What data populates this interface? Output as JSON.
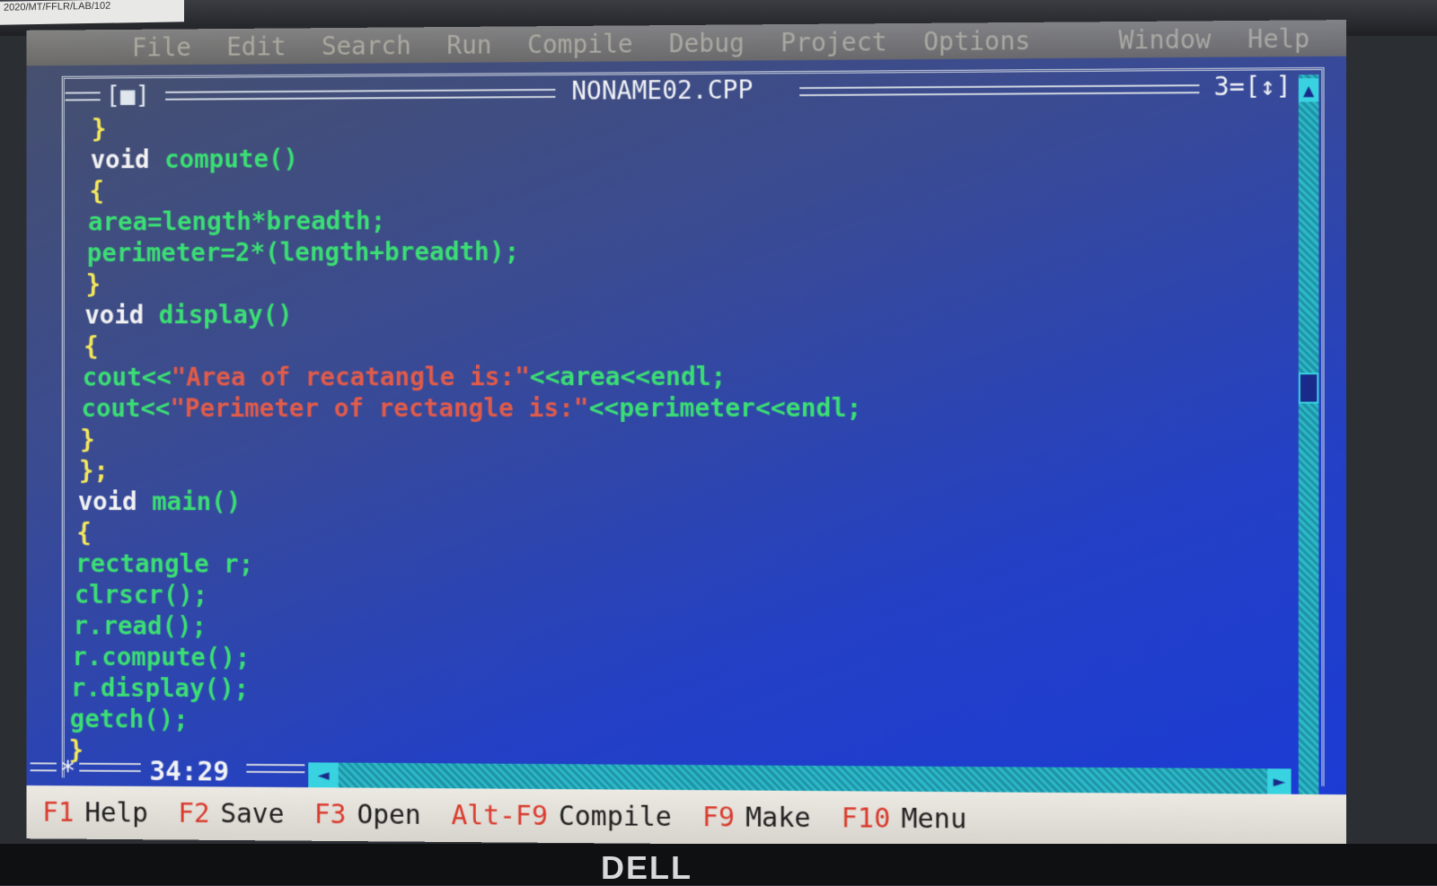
{
  "sticker": "2020/MT/FFLR/LAB/102",
  "brand": "DELL",
  "menu": [
    "File",
    "Edit",
    "Search",
    "Run",
    "Compile",
    "Debug",
    "Project",
    "Options",
    "Window",
    "Help"
  ],
  "window": {
    "close_box": "[■]",
    "filename": "NONAME02.CPP",
    "number": "3",
    "zoom_box": "[↕]"
  },
  "code_lines": [
    {
      "parts": [
        {
          "t": "}",
          "c": "br"
        }
      ]
    },
    {
      "parts": [
        {
          "t": "void ",
          "c": "kw"
        },
        {
          "t": "compute()",
          "c": "id"
        }
      ]
    },
    {
      "parts": [
        {
          "t": "{",
          "c": "br"
        }
      ]
    },
    {
      "parts": [
        {
          "t": "area=length*breadth;",
          "c": "id"
        }
      ]
    },
    {
      "parts": [
        {
          "t": "perimeter=2*(length+breadth);",
          "c": "id"
        }
      ]
    },
    {
      "parts": [
        {
          "t": "}",
          "c": "br"
        }
      ]
    },
    {
      "parts": [
        {
          "t": "void ",
          "c": "kw"
        },
        {
          "t": "display()",
          "c": "id"
        }
      ]
    },
    {
      "parts": [
        {
          "t": "{",
          "c": "br"
        }
      ]
    },
    {
      "parts": [
        {
          "t": "cout<<",
          "c": "id"
        },
        {
          "t": "\"Area of recatangle is:\"",
          "c": "str"
        },
        {
          "t": "<<area<<endl;",
          "c": "id"
        }
      ]
    },
    {
      "parts": [
        {
          "t": "cout<<",
          "c": "id"
        },
        {
          "t": "\"Perimeter of rectangle is:\"",
          "c": "str"
        },
        {
          "t": "<<perimeter<<endl;",
          "c": "id"
        }
      ]
    },
    {
      "parts": [
        {
          "t": "}",
          "c": "br"
        }
      ]
    },
    {
      "parts": [
        {
          "t": "};",
          "c": "br"
        }
      ]
    },
    {
      "parts": [
        {
          "t": "void ",
          "c": "kw"
        },
        {
          "t": "main()",
          "c": "id"
        }
      ]
    },
    {
      "parts": [
        {
          "t": "{",
          "c": "br"
        }
      ]
    },
    {
      "parts": [
        {
          "t": "rectangle r;",
          "c": "id"
        }
      ]
    },
    {
      "parts": [
        {
          "t": "clrscr();",
          "c": "id"
        }
      ]
    },
    {
      "parts": [
        {
          "t": "r.read();",
          "c": "id"
        }
      ]
    },
    {
      "parts": [
        {
          "t": "r.compute();",
          "c": "id"
        }
      ]
    },
    {
      "parts": [
        {
          "t": "r.display();",
          "c": "id"
        }
      ]
    },
    {
      "parts": [
        {
          "t": "getch();",
          "c": "id"
        }
      ]
    },
    {
      "parts": [
        {
          "t": "}",
          "c": "br"
        }
      ]
    }
  ],
  "status": {
    "modified_marker": "*",
    "cursor_position": "34:29"
  },
  "keys": [
    {
      "key": "F1",
      "action": "Help"
    },
    {
      "key": "F2",
      "action": "Save"
    },
    {
      "key": "F3",
      "action": "Open"
    },
    {
      "key": "Alt-F9",
      "action": "Compile"
    },
    {
      "key": "F9",
      "action": "Make"
    },
    {
      "key": "F10",
      "action": "Menu"
    }
  ],
  "colors": {
    "keyword": "#f2f2f2",
    "identifier": "#3bde74",
    "brace": "#f5e85a",
    "string": "#e15b4a",
    "function_key": "#d93a2d",
    "screen_blue": "#1a3bd6"
  }
}
